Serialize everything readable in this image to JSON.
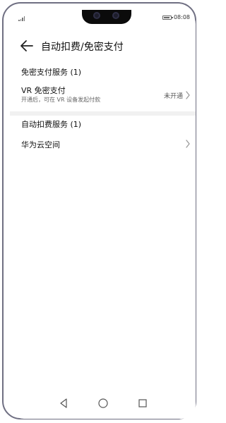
{
  "status_bar": {
    "time": "08:08"
  },
  "header": {
    "title": "自动扣费/免密支付"
  },
  "section_password_free": {
    "title": "免密支付服务 (1)",
    "item": {
      "title": "VR 免密支付",
      "subtitle": "开通后，可在 VR 设备发起付款",
      "status": "未开通"
    }
  },
  "section_auto_deduct": {
    "title": "自动扣费服务 (1)",
    "item": {
      "title": "华为云空间"
    }
  },
  "icons": {
    "back": "arrow-left-icon",
    "chevron": "chevron-right-icon",
    "nav_back": "triangle-back-icon",
    "nav_home": "circle-home-icon",
    "nav_recent": "square-recent-icon"
  },
  "colors": {
    "text_primary": "#111111",
    "text_secondary": "#666666",
    "divider": "#f1f1f1",
    "frame": "#6f6f82"
  }
}
